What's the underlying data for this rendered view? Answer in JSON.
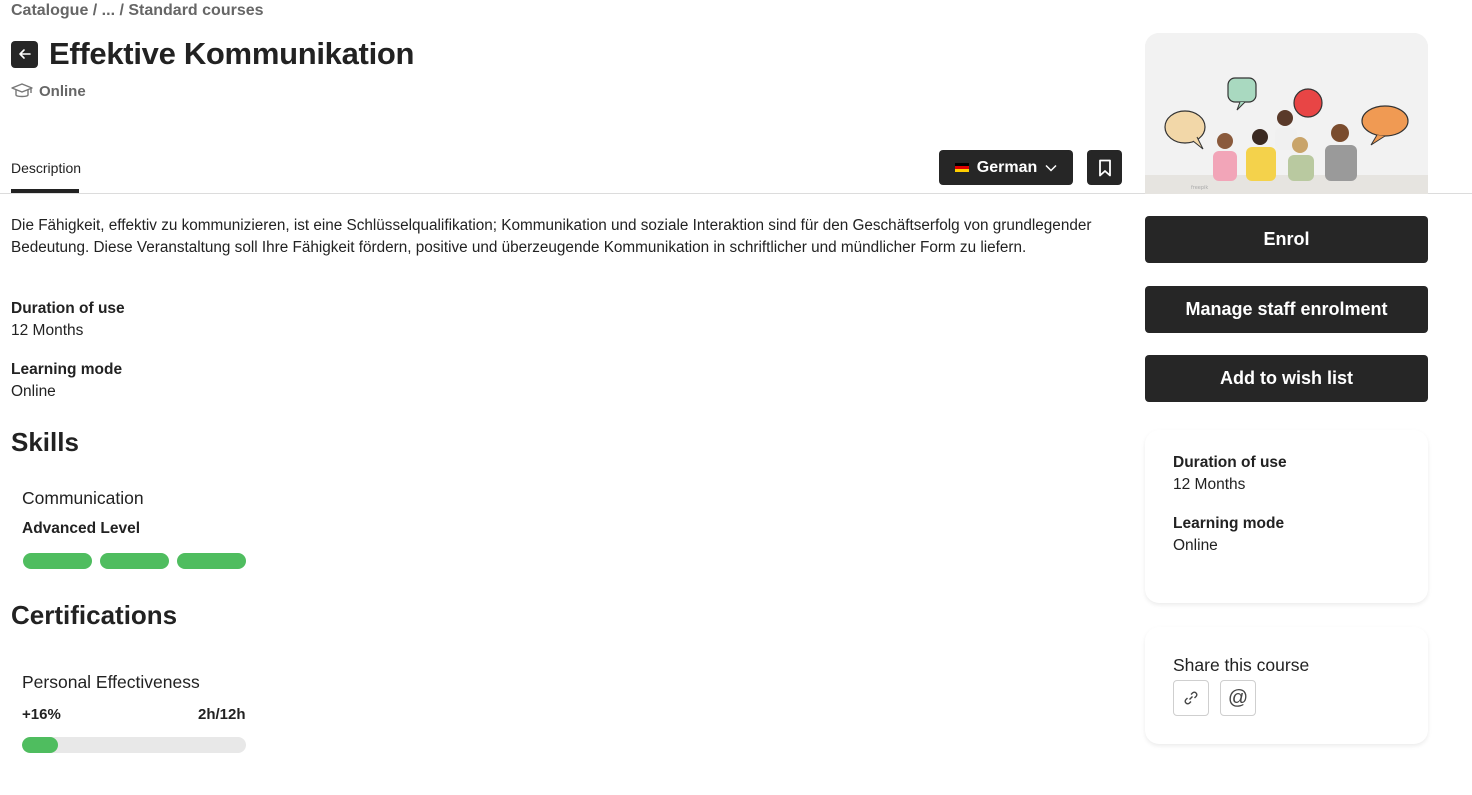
{
  "breadcrumb": "Catalogue / ... / Standard courses",
  "title": "Effektive Kommunikation",
  "learning_mode_header": "Online",
  "tabs": [
    {
      "label": "Description",
      "active": true
    }
  ],
  "language": {
    "label": "German",
    "flag": "germany-flag"
  },
  "description": "Die Fähigkeit, effektiv zu kommunizieren, ist eine Schlüsselqualifikation; Kommunikation und soziale Interaktion sind für den Geschäftserfolg von grundlegender Bedeutung. Diese Veranstaltung soll Ihre Fähigkeit fördern, positive und überzeugende Kommunikation in schriftlicher und mündlicher Form zu liefern.",
  "details": {
    "duration_label": "Duration of use",
    "duration_value": "12 Months",
    "mode_label": "Learning mode",
    "mode_value": "Online"
  },
  "skills": {
    "title": "Skills",
    "items": [
      {
        "name": "Communication",
        "level": "Advanced Level",
        "filled_segments": 3,
        "total_segments": 3
      }
    ]
  },
  "certifications": {
    "title": "Certifications",
    "items": [
      {
        "name": "Personal Effectiveness",
        "progress_label": "+16%",
        "time_label": "2h/12h",
        "progress": 0.16
      }
    ]
  },
  "actions": {
    "enrol": "Enrol",
    "manage_staff": "Manage staff enrolment",
    "wishlist": "Add to wish list"
  },
  "side_card": {
    "duration_label": "Duration of use",
    "duration_value": "12 Months",
    "mode_label": "Learning mode",
    "mode_value": "Online"
  },
  "share": {
    "title": "Share this course",
    "icons": [
      "link-icon",
      "at-icon"
    ]
  },
  "image_watermark": "freepik",
  "colors": {
    "dark": "#262626",
    "accent_green": "#4fbd5f",
    "track": "#e8e8e8"
  }
}
